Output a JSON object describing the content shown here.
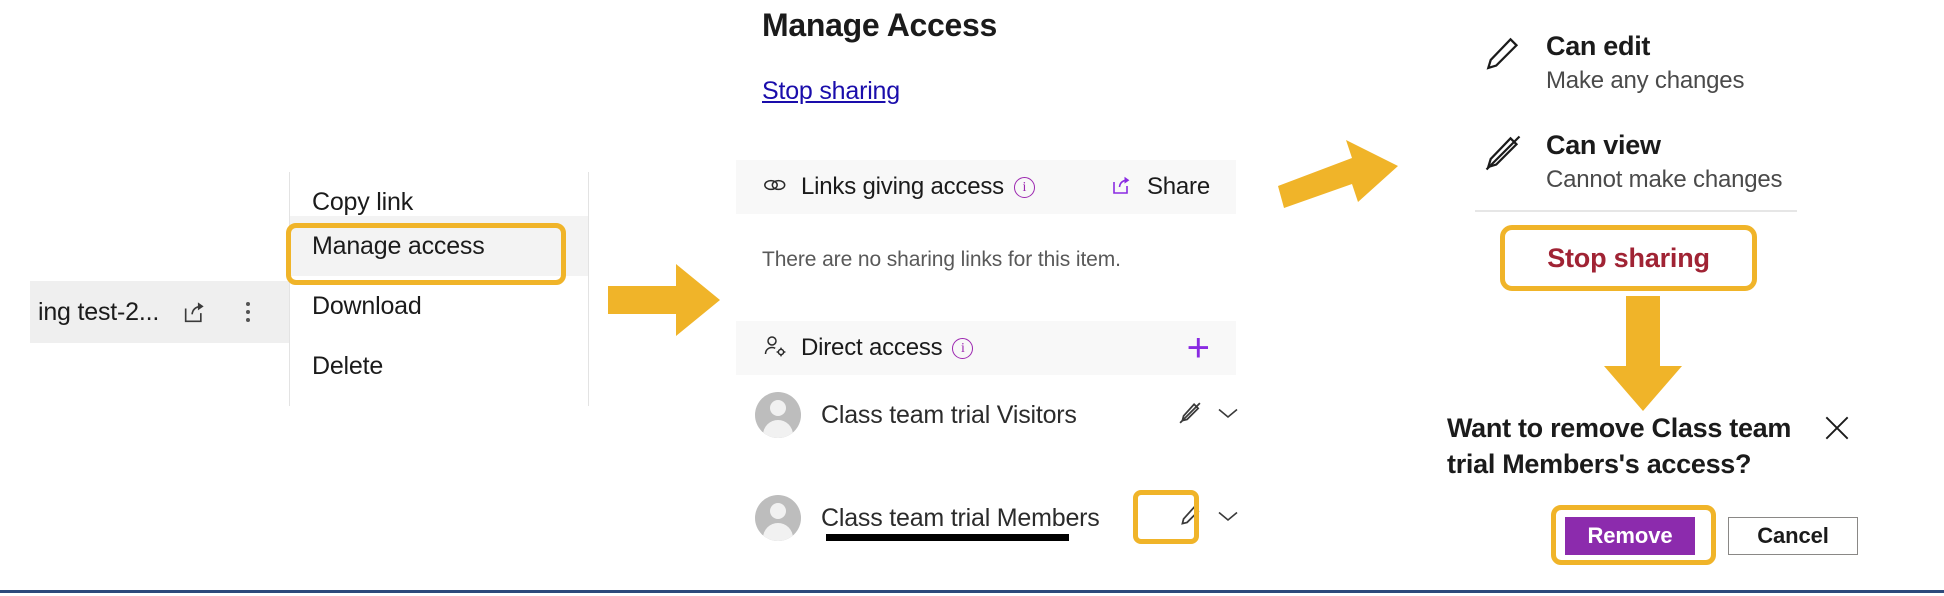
{
  "colors": {
    "highlight": "#f0b429",
    "arrow": "#f0b429",
    "accent_purple": "#8a2be2",
    "remove_button": "#8c2bad",
    "link_blue": "#1a0dab",
    "stop_sharing_red": "#a02334",
    "bottom_rule": "#2d4a7c"
  },
  "file_row": {
    "name": "ing test-2...",
    "share_icon": "share-icon",
    "more_icon": "more-vertical-icon"
  },
  "context_menu": {
    "items": [
      {
        "label": "Copy link",
        "highlighted": false
      },
      {
        "label": "Manage access",
        "highlighted": true
      },
      {
        "label": "Download",
        "highlighted": false
      },
      {
        "label": "Delete",
        "highlighted": false
      }
    ]
  },
  "center_panel": {
    "title": "Manage Access",
    "stop_sharing_link": "Stop sharing",
    "links_section": {
      "icon": "link-icon",
      "label": "Links giving access",
      "info_icon": "info-icon",
      "info_glyph": "i",
      "share_button": "Share",
      "share_icon": "share-icon",
      "empty_text": "There are no sharing links for this item."
    },
    "direct_section": {
      "icon": "person-settings-icon",
      "label": "Direct access",
      "info_icon": "info-icon",
      "info_glyph": "i",
      "add_icon": "plus-icon",
      "add_glyph": "+"
    },
    "people": [
      {
        "name": "Class team trial Visitors",
        "permission_icon": "pencil-slash-icon",
        "chevron_icon": "chevron-down-icon",
        "highlighted": false
      },
      {
        "name": "Class team trial Members",
        "permission_icon": "pencil-icon",
        "chevron_icon": "chevron-down-icon",
        "highlighted": true
      }
    ]
  },
  "right_panel": {
    "permissions": [
      {
        "icon": "pencil-icon",
        "title": "Can edit",
        "subtitle": "Make any changes"
      },
      {
        "icon": "pencil-slash-icon",
        "title": "Can view",
        "subtitle": "Cannot make changes"
      }
    ],
    "stop_sharing_button": "Stop sharing"
  },
  "confirm_dialog": {
    "title": "Want to remove Class team trial Members's access?",
    "close_icon": "close-icon",
    "remove_button": "Remove",
    "cancel_button": "Cancel"
  },
  "annotations": {
    "arrows": [
      {
        "name": "arrow-menu-to-panel",
        "direction": "right"
      },
      {
        "name": "arrow-panel-to-permissions",
        "direction": "right-tilted"
      },
      {
        "name": "arrow-stop-sharing-to-dialog",
        "direction": "down"
      }
    ],
    "highlight_boxes": [
      "manage-access-menu-item",
      "members-permission-control",
      "stop-sharing-button",
      "remove-button"
    ]
  }
}
